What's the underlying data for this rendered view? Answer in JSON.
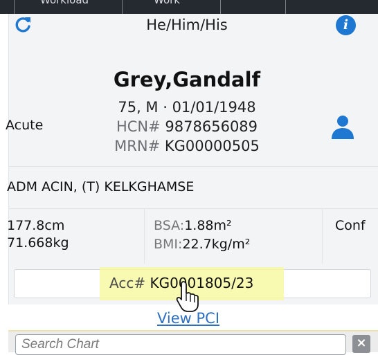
{
  "top_nav": {
    "tabs": [
      "Workload",
      "Work"
    ]
  },
  "patient_banner": {
    "pronouns": "He/Him/His",
    "name": "Grey,Gandalf",
    "age_sex_dob": "75, M  ·  01/01/1948",
    "hcn_label": "HCN#",
    "hcn": "9878656089",
    "mrn_label": "MRN#",
    "mrn": "KG00000505",
    "acuity": "Acute",
    "admission": "ADM ACIN, (T)  KELKGHAMSE",
    "height": "177.8cm",
    "weight": "71.668kg",
    "bsa_label": "BSA:",
    "bsa": "1.88m²",
    "bmi_label": "BMI:",
    "bmi": "22.7kg/m²",
    "conf": "Conf",
    "acc_label": "Acc#",
    "acc": "KG0001805/23",
    "view_pci": "View PCI"
  },
  "search": {
    "placeholder": "Search Chart",
    "clear_label": "×"
  },
  "colors": {
    "accent": "#1e78d2",
    "highlight": "#f7f9a5",
    "topbar": "#252a31",
    "link": "#2e6fc0"
  },
  "icons": [
    "refresh-icon",
    "info-icon",
    "person-icon",
    "hand-cursor-icon"
  ]
}
